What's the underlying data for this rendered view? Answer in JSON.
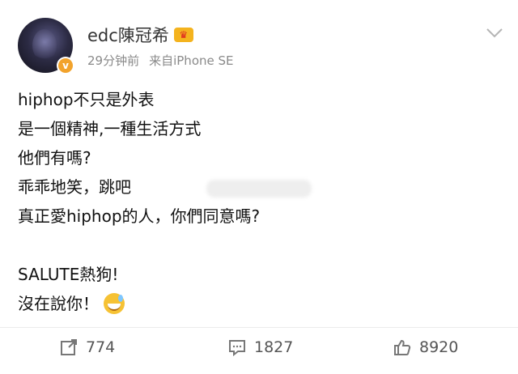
{
  "post": {
    "author": "edc陳冠希",
    "time": "29分钟前",
    "source": "来自iPhone SE",
    "lines": [
      "hiphop不只是外表",
      "是一個精神,一種生活方式",
      "他們有嗎?",
      "乖乖地笑，跳吧",
      "真正愛hiphop的人，你們同意嗎?",
      "",
      "SALUTE熱狗!",
      "沒在說你！"
    ]
  },
  "actions": {
    "repost": "774",
    "comment": "1827",
    "like": "8920"
  },
  "icons": {
    "verified": "verified-badge-icon",
    "crown": "member-crown-icon",
    "menu": "chevron-down-icon",
    "emoji": "grinning-sweat-emoji-icon",
    "repost": "repost-icon",
    "comment": "comment-icon",
    "like": "thumbs-up-icon"
  },
  "colors": {
    "meta_text": "#8a8a8a",
    "badge": "#f2a32c"
  }
}
